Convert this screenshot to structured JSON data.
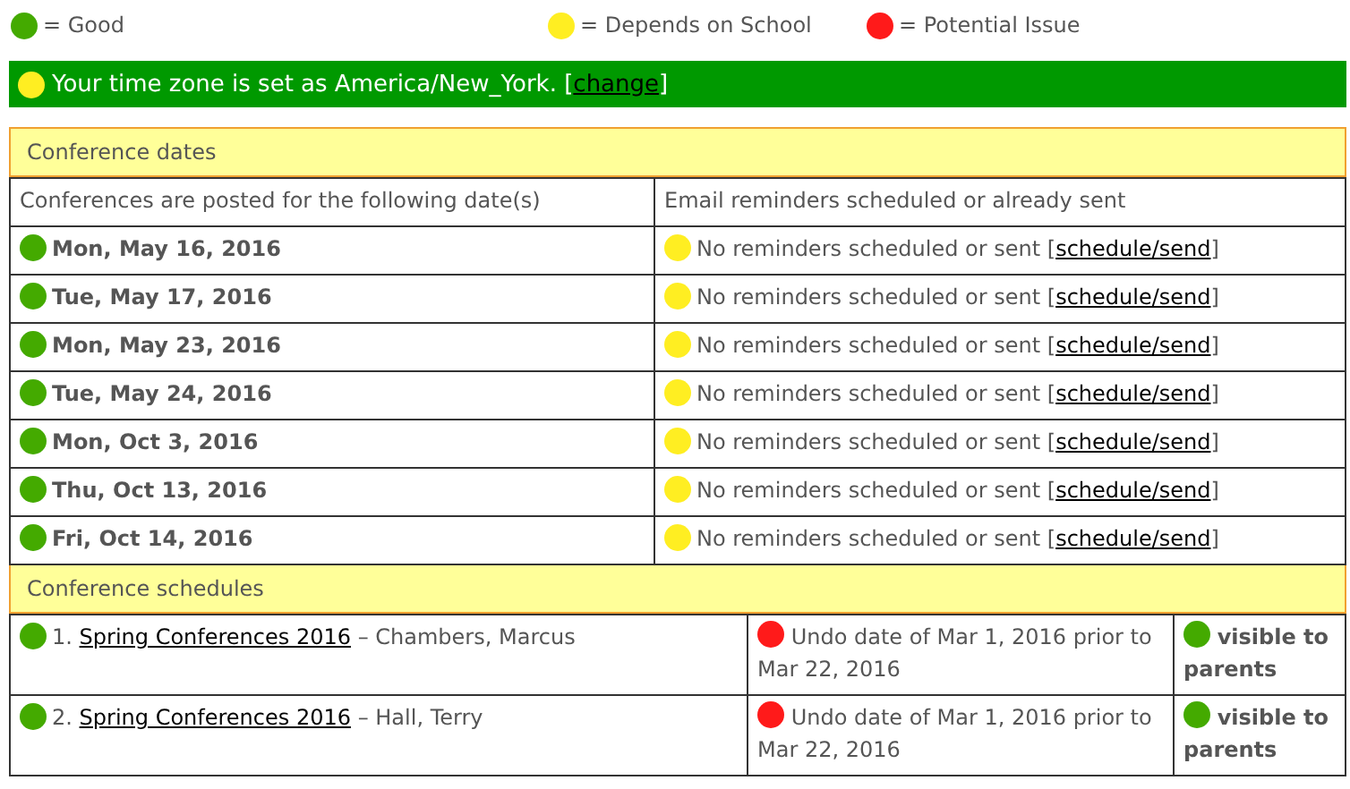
{
  "legend": [
    {
      "color": "#44aa00",
      "label": "= Good"
    },
    {
      "color": "#ffee22",
      "label": "= Depends on School"
    },
    {
      "color": "#ff1a1a",
      "label": "= Potential Issue"
    }
  ],
  "timezone_banner": {
    "color": "#ffee22",
    "text": "Your time zone is set as America/New_York. [",
    "link": "change",
    "after": "]"
  },
  "conference_dates": {
    "title": "Conference dates",
    "columns": [
      "Conferences are posted for the following date(s)",
      "Email reminders scheduled or already sent"
    ],
    "rows": [
      {
        "date": {
          "color": "#44aa00",
          "text": "Mon, May 16, 2016"
        },
        "reminder": {
          "color": "#ffee22",
          "text": "No reminders scheduled or sent [",
          "link": "schedule/send",
          "after": "]"
        }
      },
      {
        "date": {
          "color": "#44aa00",
          "text": "Tue, May 17, 2016"
        },
        "reminder": {
          "color": "#ffee22",
          "text": "No reminders scheduled or sent [",
          "link": "schedule/send",
          "after": "]"
        }
      },
      {
        "date": {
          "color": "#44aa00",
          "text": "Mon, May 23, 2016"
        },
        "reminder": {
          "color": "#ffee22",
          "text": "No reminders scheduled or sent [",
          "link": "schedule/send",
          "after": "]"
        }
      },
      {
        "date": {
          "color": "#44aa00",
          "text": "Tue, May 24, 2016"
        },
        "reminder": {
          "color": "#ffee22",
          "text": "No reminders scheduled or sent [",
          "link": "schedule/send",
          "after": "]"
        }
      },
      {
        "date": {
          "color": "#44aa00",
          "text": "Mon, Oct 3, 2016"
        },
        "reminder": {
          "color": "#ffee22",
          "text": "No reminders scheduled or sent [",
          "link": "schedule/send",
          "after": "]"
        }
      },
      {
        "date": {
          "color": "#44aa00",
          "text": "Thu, Oct 13, 2016"
        },
        "reminder": {
          "color": "#ffee22",
          "text": "No reminders scheduled or sent [",
          "link": "schedule/send",
          "after": "]"
        }
      },
      {
        "date": {
          "color": "#44aa00",
          "text": "Fri, Oct 14, 2016"
        },
        "reminder": {
          "color": "#ffee22",
          "text": "No reminders scheduled or sent [",
          "link": "schedule/send",
          "after": "]"
        }
      }
    ]
  },
  "conference_schedules": {
    "title": "Conference schedules",
    "rows": [
      {
        "entry": {
          "color": "#44aa00",
          "number": "1.",
          "name": "Spring Conferences 2016",
          "teacher": "– Chambers, Marcus"
        },
        "undo": {
          "color": "#ff1a1a",
          "text": "Undo date of Mar 1, 2016 prior to Mar 22, 2016"
        },
        "visibility": {
          "color": "#44aa00",
          "text": "visible to parents"
        }
      },
      {
        "entry": {
          "color": "#44aa00",
          "number": "2.",
          "name": "Spring Conferences 2016",
          "teacher": "– Hall, Terry"
        },
        "undo": {
          "color": "#ff1a1a",
          "text": "Undo date of Mar 1, 2016 prior to Mar 22, 2016"
        },
        "visibility": {
          "color": "#44aa00",
          "text": "visible to parents"
        }
      }
    ]
  }
}
